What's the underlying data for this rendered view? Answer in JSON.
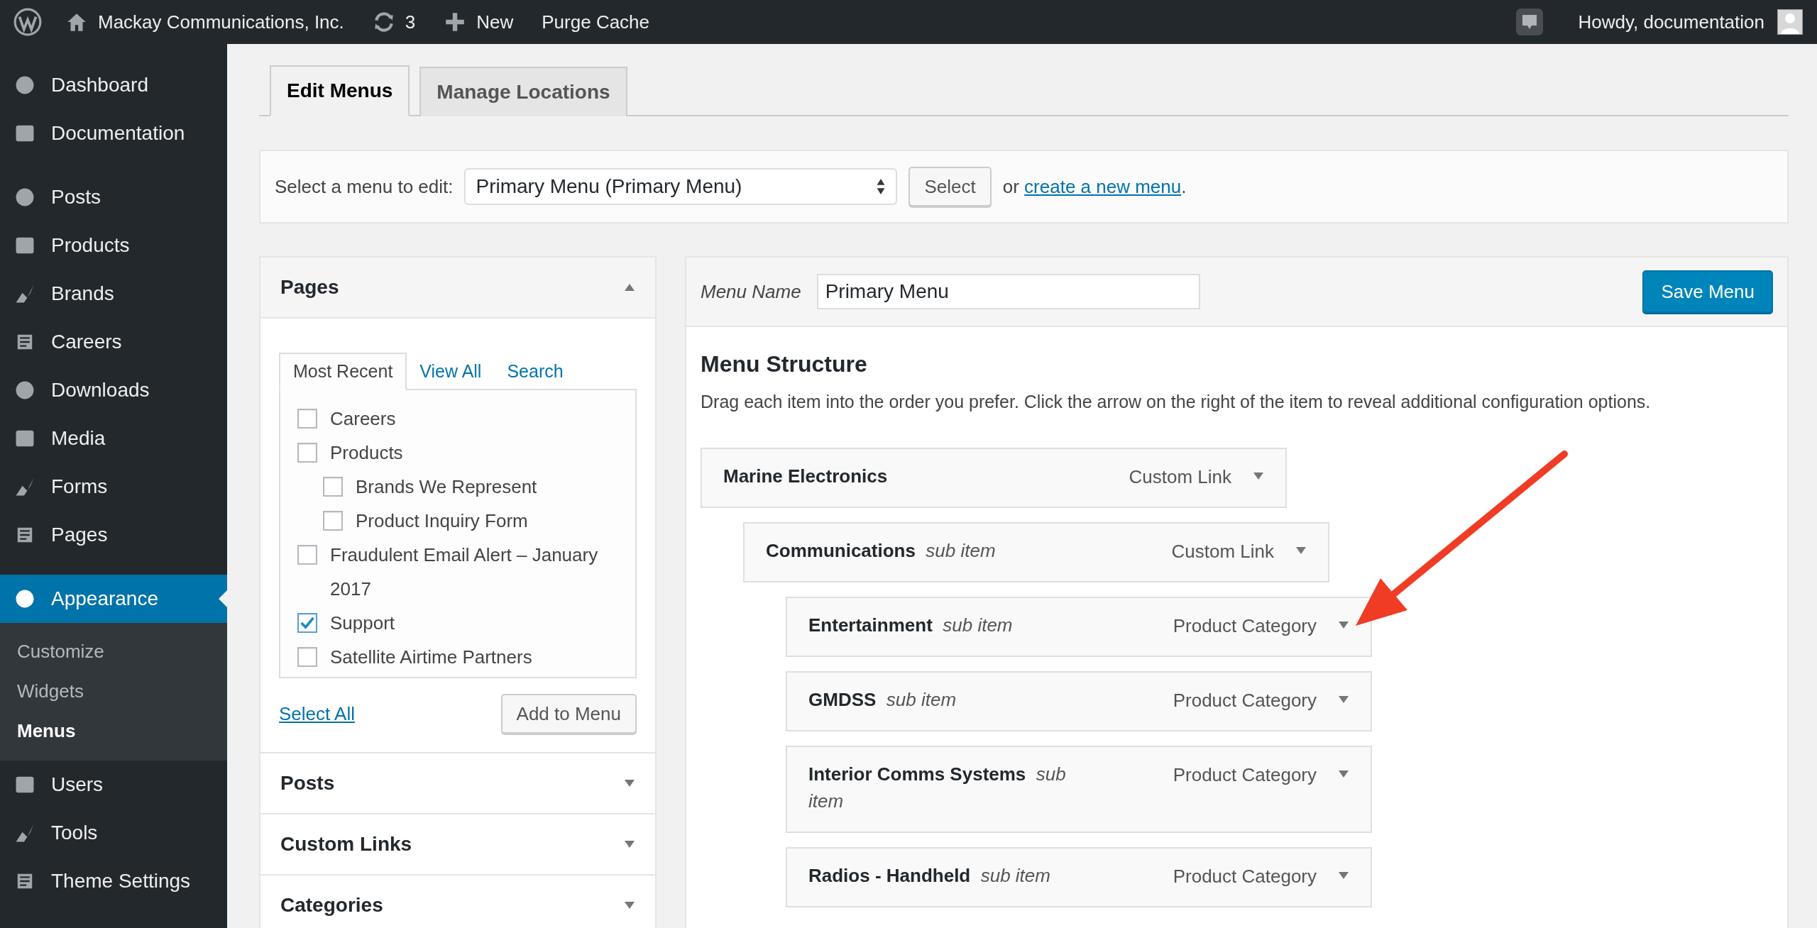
{
  "admin_bar": {
    "site_name": "Mackay Communications, Inc.",
    "updates_count": "3",
    "new_label": "New",
    "purge_label": "Purge Cache",
    "greeting": "Howdy, documentation"
  },
  "sidebar": {
    "groups": [
      {
        "items": [
          {
            "label": "Dashboard",
            "selected": false
          },
          {
            "label": "Documentation",
            "selected": false
          }
        ]
      },
      {
        "items": [
          {
            "label": "Posts",
            "selected": false
          },
          {
            "label": "Products",
            "selected": false
          },
          {
            "label": "Brands",
            "selected": false
          },
          {
            "label": "Careers",
            "selected": false
          },
          {
            "label": "Downloads",
            "selected": false
          },
          {
            "label": "Media",
            "selected": false
          },
          {
            "label": "Forms",
            "selected": false
          },
          {
            "label": "Pages",
            "selected": false
          }
        ]
      },
      {
        "items": [
          {
            "label": "Appearance",
            "selected": true,
            "children": [
              {
                "label": "Customize",
                "selected": false
              },
              {
                "label": "Widgets",
                "selected": false
              },
              {
                "label": "Menus",
                "selected": true
              }
            ]
          },
          {
            "label": "Users",
            "selected": false
          },
          {
            "label": "Tools",
            "selected": false
          },
          {
            "label": "Theme Settings",
            "selected": false
          }
        ]
      }
    ]
  },
  "tabs": [
    {
      "label": "Edit Menus",
      "selected": true
    },
    {
      "label": "Manage Locations",
      "selected": false
    }
  ],
  "menu_select": {
    "label": "Select a menu to edit:",
    "value": "Primary Menu (Primary Menu)",
    "button": "Select",
    "or_text": "or",
    "link": "create a new menu",
    "tail": "."
  },
  "pages_box": {
    "title": "Pages",
    "expanded": true,
    "tabs": [
      {
        "label": "Most Recent",
        "selected": true
      },
      {
        "label": "View All",
        "selected": false
      },
      {
        "label": "Search",
        "selected": false
      }
    ],
    "items": [
      {
        "label": "Careers",
        "checked": false
      },
      {
        "label": "Products",
        "checked": false,
        "children": [
          {
            "label": "Brands We Represent",
            "checked": false
          },
          {
            "label": "Product Inquiry Form",
            "checked": false
          }
        ]
      },
      {
        "label": "Fraudulent Email Alert – January 2017",
        "checked": false
      },
      {
        "label": "Support",
        "checked": true
      },
      {
        "label": "Satellite Airtime Partners",
        "checked": false
      }
    ],
    "select_all": "Select All",
    "add_button": "Add to Menu"
  },
  "accordions": [
    {
      "title": "Posts",
      "expanded": false
    },
    {
      "title": "Custom Links",
      "expanded": false
    },
    {
      "title": "Categories",
      "expanded": false
    }
  ],
  "menu_editor": {
    "name_label": "Menu Name",
    "name_value": "Primary Menu",
    "save_button": "Save Menu",
    "heading": "Menu Structure",
    "description": "Drag each item into the order you prefer. Click the arrow on the right of the item to reveal additional configuration options.",
    "items": [
      {
        "title": "Marine Electronics",
        "type": "Custom Link",
        "children": [
          {
            "title": "Communications",
            "note": "sub item",
            "type": "Custom Link",
            "children": [
              {
                "title": "Entertainment",
                "note": "sub item",
                "type": "Product Category"
              },
              {
                "title": "GMDSS",
                "note": "sub item",
                "type": "Product Category"
              },
              {
                "title": "Interior Comms Systems",
                "note": "sub item",
                "type": "Product Category"
              },
              {
                "title": "Radios - Handheld",
                "note": "sub item",
                "type": "Product Category"
              }
            ]
          }
        ]
      }
    ]
  }
}
